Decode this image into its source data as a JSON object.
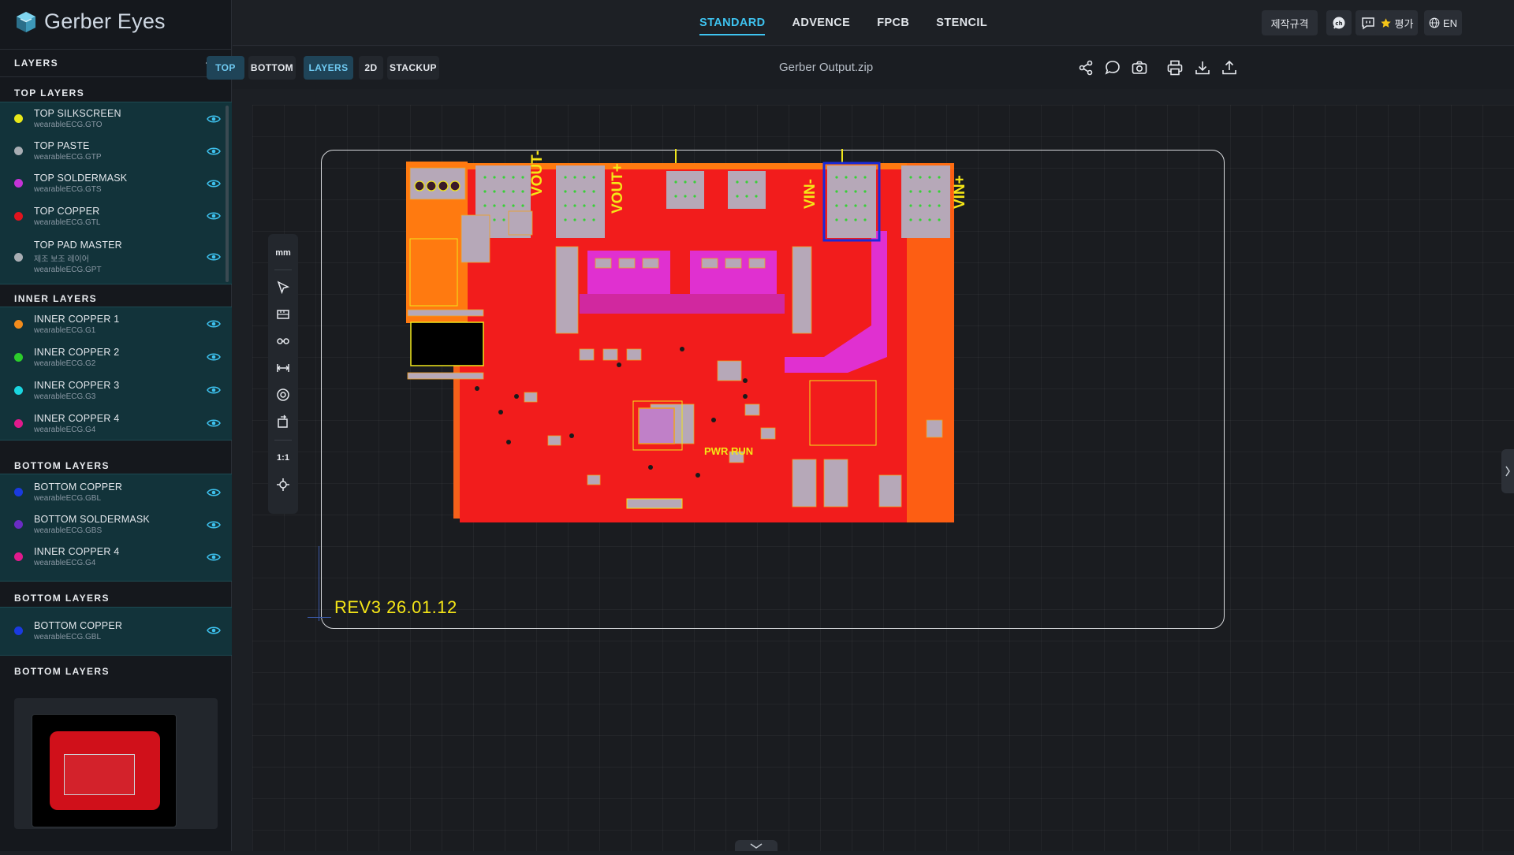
{
  "app": {
    "logo_text": "Gerber Eyes"
  },
  "main_tabs": [
    "STANDARD",
    "ADVENCE",
    "FPCB",
    "STENCIL"
  ],
  "header_buttons": {
    "spec": "제작규격",
    "rating": "평가",
    "language": "EN"
  },
  "toolbar": {
    "view_top": "TOP",
    "view_bottom": "BOTTOM",
    "mode_layers": "LAYERS",
    "mode_2d": "2D",
    "mode_stackup": "STACKUP",
    "file_name": "Gerber Output.zip"
  },
  "sidebar": {
    "layers_title": "LAYERS",
    "groups": [
      {
        "title": "TOP LAYERS",
        "items": [
          {
            "name": "TOP SILKSCREEN",
            "file": "wearableECG.GTO",
            "color": "#e8e81a"
          },
          {
            "name": "TOP PASTE",
            "file": "wearableECG.GTP",
            "color": "#a8adb3"
          },
          {
            "name": "TOP SOLDERMASK",
            "file": "wearableECG.GTS",
            "color": "#c433d6"
          },
          {
            "name": "TOP COPPER",
            "file": "wearableECG.GTL",
            "color": "#e0141e"
          },
          {
            "name": "TOP PAD MASTER",
            "sub": "제조 보조 레이어",
            "file": "wearableECG.GPT",
            "color": "#a8adb3"
          }
        ]
      },
      {
        "title": "INNER LAYERS",
        "items": [
          {
            "name": "INNER COPPER 1",
            "file": "wearableECG.G1",
            "color": "#f28c1c"
          },
          {
            "name": "INNER COPPER 2",
            "file": "wearableECG.G2",
            "color": "#2ccc2c"
          },
          {
            "name": "INNER COPPER 3",
            "file": "wearableECG.G3",
            "color": "#1ad6e0"
          },
          {
            "name": "INNER COPPER 4",
            "file": "wearableECG.G4",
            "color": "#e01a8c"
          }
        ]
      },
      {
        "title": "BOTTOM LAYERS",
        "items": [
          {
            "name": "BOTTOM COPPER",
            "file": "wearableECG.GBL",
            "color": "#1a3ae0"
          },
          {
            "name": "BOTTOM SOLDERMASK",
            "file": "wearableECG.GBS",
            "color": "#6a2cc4"
          },
          {
            "name": "INNER COPPER 4",
            "file": "wearableECG.G4",
            "color": "#e01a8c"
          }
        ]
      },
      {
        "title": "BOTTOM LAYERS",
        "items": [
          {
            "name": "BOTTOM COPPER",
            "file": "wearableECG.GBL",
            "color": "#1a3ae0"
          }
        ]
      }
    ],
    "preview_title": "BOTTOM LAYERS"
  },
  "viewer": {
    "unit": "mm",
    "zoom_reset": "1:1",
    "board_labels": {
      "rev": "REV3  26.01.12",
      "vout_minus": "VOUT-",
      "vout_plus": "VOUT+",
      "vin_minus": "VIN-",
      "vin_plus": "VIN+",
      "pwr_run": "PWR RUN"
    }
  }
}
